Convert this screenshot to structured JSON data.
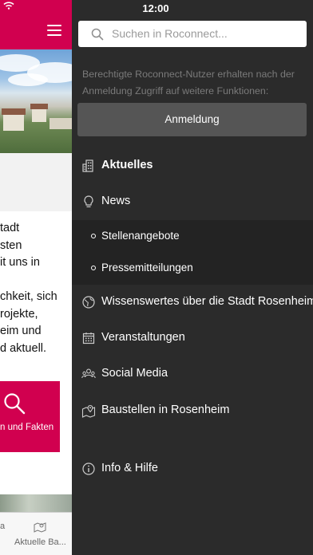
{
  "status_bar": {
    "time": "12:00"
  },
  "search": {
    "placeholder": "Suchen in Roconnect..."
  },
  "login_info": "Berechtigte Roconnect-Nutzer erhalten nach der Anmeldung Zugriff auf weitere Funktionen:",
  "login_button": "Anmeldung",
  "menu": {
    "aktuelles": {
      "label": "Aktuelles",
      "icon": "building-icon"
    },
    "news": {
      "label": "News",
      "icon": "lightbulb-icon"
    },
    "news_sub": [
      {
        "label": "Stellenangebote"
      },
      {
        "label": "Pressemitteilungen"
      }
    ],
    "wissenswertes": {
      "label": "Wissenswertes über die Stadt Rosenheim",
      "icon": "globe-icon"
    },
    "veranstaltungen": {
      "label": "Veranstaltungen",
      "icon": "calendar-icon"
    },
    "social": {
      "label": "Social Media",
      "icon": "people-icon"
    },
    "baustellen": {
      "label": "Baustellen in Rosenheim",
      "icon": "map-pin-icon"
    },
    "info": {
      "label": "Info & Hilfe",
      "icon": "info-icon"
    }
  },
  "background": {
    "text_lines": [
      "tadt",
      "sten",
      "it uns in",
      "",
      "chkeit, sich",
      "rojekte,",
      "eim und",
      "d aktuell."
    ],
    "card_label": "n und Fakten",
    "tab_left": "a",
    "tab_label": "Aktuelle Ba..."
  },
  "colors": {
    "brand": "#d1004f",
    "drawer_bg": "#2b2b2b",
    "login_button": "#555555"
  }
}
